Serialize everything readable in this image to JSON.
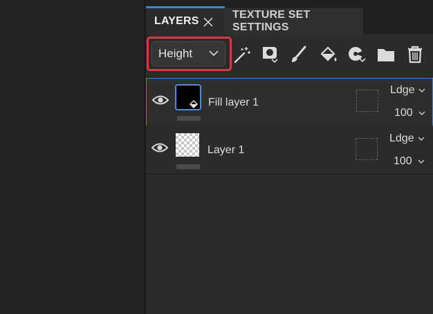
{
  "tabs": [
    {
      "label": "LAYERS"
    },
    {
      "label": "TEXTURE SET SETTINGS"
    }
  ],
  "toolbar": {
    "channel": "Height",
    "tools": [
      "magic-wand-icon",
      "smart-material-icon",
      "brush-icon",
      "fill-bucket-icon",
      "effects-icon",
      "folder-icon",
      "trash-icon"
    ]
  },
  "layers": [
    {
      "name": "Fill layer 1",
      "blend": "Ldge",
      "opacity": "100",
      "selected": true
    },
    {
      "name": "Layer 1",
      "blend": "Ldge",
      "opacity": "100",
      "selected": false
    }
  ],
  "colors": {
    "accent": "#3d86d6",
    "highlight": "#d73b3b"
  }
}
